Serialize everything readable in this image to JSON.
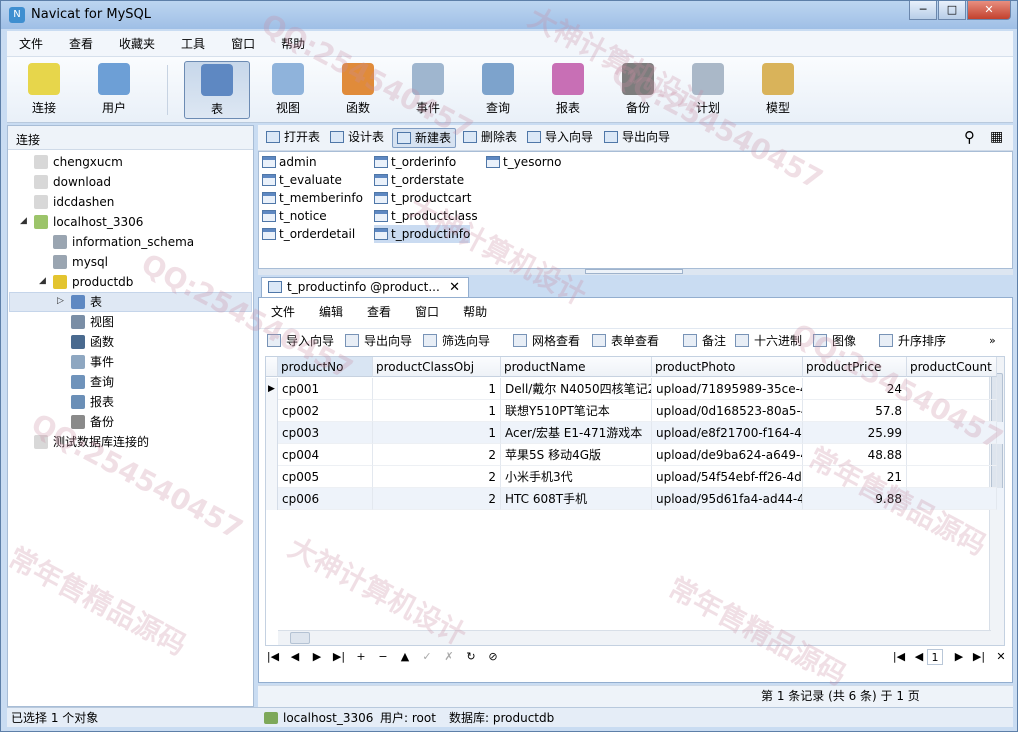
{
  "window": {
    "title": "Navicat for MySQL",
    "controls": [
      "─",
      "□",
      "✕"
    ]
  },
  "menu": [
    "文件",
    "查看",
    "收藏夹",
    "工具",
    "窗口",
    "帮助"
  ],
  "toolbar": [
    {
      "label": "连接",
      "icon": "plug-icon",
      "color": "#e7d64b"
    },
    {
      "label": "用户",
      "icon": "user-icon",
      "color": "#6d9fd6"
    },
    {
      "label": "表",
      "icon": "table-icon",
      "color": "#5e88c2"
    },
    {
      "label": "视图",
      "icon": "view-icon",
      "color": "#8fb3db"
    },
    {
      "label": "函数",
      "icon": "function-icon",
      "color": "#e08b3a"
    },
    {
      "label": "事件",
      "icon": "event-icon",
      "color": "#9fb6cf"
    },
    {
      "label": "查询",
      "icon": "query-icon",
      "color": "#7da3cc"
    },
    {
      "label": "报表",
      "icon": "report-icon",
      "color": "#c86fb5"
    },
    {
      "label": "备份",
      "icon": "backup-icon",
      "color": "#7d7d7d"
    },
    {
      "label": "计划",
      "icon": "schedule-icon",
      "color": "#aab8c8"
    },
    {
      "label": "模型",
      "icon": "model-icon",
      "color": "#d9b35a"
    }
  ],
  "left_panel": {
    "header": "连接",
    "tree": [
      {
        "label": "chengxucm",
        "level": 0,
        "icon": "connection-icon"
      },
      {
        "label": "download",
        "level": 0,
        "icon": "connection-icon"
      },
      {
        "label": "idcdashen",
        "level": 0,
        "icon": "connection-icon"
      },
      {
        "label": "localhost_3306",
        "level": 0,
        "icon": "connection-open-icon",
        "expanded": true
      },
      {
        "label": "information_schema",
        "level": 1,
        "icon": "database-icon"
      },
      {
        "label": "mysql",
        "level": 1,
        "icon": "database-icon"
      },
      {
        "label": "productdb",
        "level": 1,
        "icon": "database-open-icon",
        "expanded": true
      },
      {
        "label": "表",
        "level": 2,
        "icon": "table-icon",
        "selected": true
      },
      {
        "label": "视图",
        "level": 2,
        "icon": "view-icon"
      },
      {
        "label": "函数",
        "level": 2,
        "icon": "function-icon"
      },
      {
        "label": "事件",
        "level": 2,
        "icon": "event-icon"
      },
      {
        "label": "查询",
        "level": 2,
        "icon": "query-icon"
      },
      {
        "label": "报表",
        "level": 2,
        "icon": "report-icon"
      },
      {
        "label": "备份",
        "level": 2,
        "icon": "backup-icon"
      },
      {
        "label": "测试数据库连接的",
        "level": 0,
        "icon": "connection-icon"
      }
    ]
  },
  "object_toolbar": [
    "打开表",
    "设计表",
    "新建表",
    "删除表",
    "导入向导",
    "导出向导"
  ],
  "tables": [
    "admin",
    "t_evaluate",
    "t_memberinfo",
    "t_notice",
    "t_orderdetail",
    "t_orderinfo",
    "t_orderstate",
    "t_productcart",
    "t_productclass",
    "t_productinfo",
    "t_yesorno"
  ],
  "tab": {
    "label": "t_productinfo @product...",
    "close": "✕"
  },
  "sub_menu": [
    "文件",
    "编辑",
    "查看",
    "窗口",
    "帮助"
  ],
  "sub_toolbar": [
    "导入向导",
    "导出向导",
    "筛选向导",
    "网格查看",
    "表单查看",
    "备注",
    "十六进制",
    "图像",
    "升序排序"
  ],
  "grid": {
    "columns": [
      "productNo",
      "productClassObj",
      "productName",
      "productPhoto",
      "productPrice",
      "productCount"
    ],
    "rows": [
      [
        "cp001",
        "1",
        "Dell/戴尔 N4050四核笔记2",
        "upload/71895989-35ce-4",
        "24",
        ""
      ],
      [
        "cp002",
        "1",
        "联想Y510PT笔记本",
        "upload/0d168523-80a5-4",
        "57.8",
        ""
      ],
      [
        "cp003",
        "1",
        "Acer/宏基 E1-471游戏本",
        "upload/e8f21700-f164-4c",
        "25.99",
        ""
      ],
      [
        "cp004",
        "2",
        "苹果5S 移动4G版",
        "upload/de9ba624-a649-4",
        "48.88",
        ""
      ],
      [
        "cp005",
        "2",
        "小米手机3代",
        "upload/54f54ebf-ff26-4d",
        "21",
        ""
      ],
      [
        "cp006",
        "2",
        "HTC 608T手机",
        "upload/95d61fa4-ad44-4",
        "9.88",
        ""
      ]
    ]
  },
  "navbar": {
    "buttons": [
      "|◀",
      "◀",
      "▶",
      "▶|",
      "+",
      "−",
      "▲",
      "✓",
      "✗",
      "↻",
      "⊘"
    ],
    "page": "1"
  },
  "record_status": "第 1 条记录 (共 6 条) 于 1 页",
  "statusbar": {
    "selection": "已选择 1 个对象",
    "connection": "localhost_3306",
    "user": "用户: root",
    "database": "数据库: productdb"
  },
  "watermarks": [
    "QQ:254540457",
    "大神计算机设计",
    "常年售精品源码"
  ]
}
